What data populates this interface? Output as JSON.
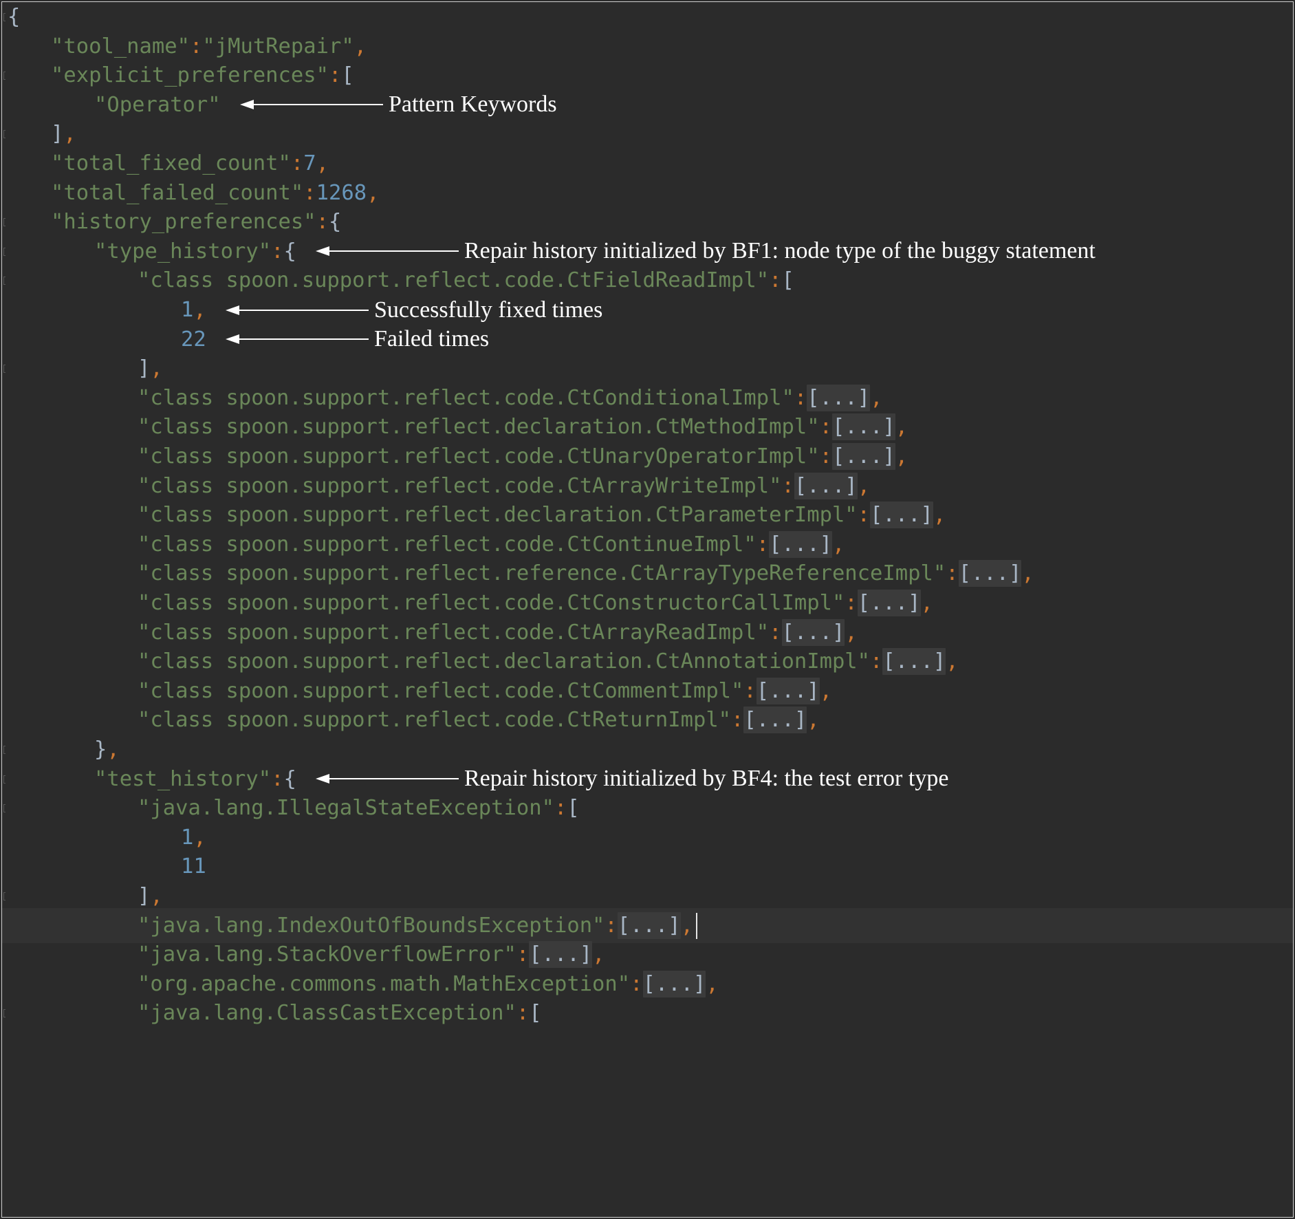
{
  "editor": {
    "language": "json",
    "lines": [
      {
        "indent": 0,
        "tokens": [
          {
            "t": "{",
            "c": "b"
          }
        ]
      },
      {
        "indent": 1,
        "tokens": [
          {
            "t": "\"tool_name\"",
            "c": "s"
          },
          {
            "t": ":",
            "c": "p"
          },
          {
            "t": "\"jMutRepair\"",
            "c": "s"
          },
          {
            "t": ",",
            "c": "p"
          }
        ]
      },
      {
        "indent": 1,
        "tokens": [
          {
            "t": "\"explicit_preferences\"",
            "c": "s"
          },
          {
            "t": ":",
            "c": "p"
          },
          {
            "t": "[",
            "c": "b"
          }
        ]
      },
      {
        "indent": 2,
        "tokens": [
          {
            "t": "\"Operator\"",
            "c": "s"
          }
        ]
      },
      {
        "indent": 1,
        "tokens": [
          {
            "t": "]",
            "c": "b"
          },
          {
            "t": ",",
            "c": "p"
          }
        ]
      },
      {
        "indent": 1,
        "tokens": [
          {
            "t": "\"total_fixed_count\"",
            "c": "s"
          },
          {
            "t": ":",
            "c": "p"
          },
          {
            "t": "7",
            "c": "n"
          },
          {
            "t": ",",
            "c": "p"
          }
        ]
      },
      {
        "indent": 1,
        "tokens": [
          {
            "t": "\"total_failed_count\"",
            "c": "s"
          },
          {
            "t": ":",
            "c": "p"
          },
          {
            "t": "1268",
            "c": "n"
          },
          {
            "t": ",",
            "c": "p"
          }
        ]
      },
      {
        "indent": 1,
        "tokens": [
          {
            "t": "\"history_preferences\"",
            "c": "s"
          },
          {
            "t": ":",
            "c": "p"
          },
          {
            "t": "{",
            "c": "b"
          }
        ]
      },
      {
        "indent": 2,
        "tokens": [
          {
            "t": "\"type_history\"",
            "c": "s"
          },
          {
            "t": ":",
            "c": "p"
          },
          {
            "t": "{",
            "c": "b"
          }
        ]
      },
      {
        "indent": 3,
        "tokens": [
          {
            "t": "\"class spoon.support.reflect.code.CtFieldReadImpl\"",
            "c": "s"
          },
          {
            "t": ":",
            "c": "p"
          },
          {
            "t": "[",
            "c": "b"
          }
        ]
      },
      {
        "indent": 4,
        "tokens": [
          {
            "t": "1",
            "c": "n"
          },
          {
            "t": ",",
            "c": "p"
          }
        ]
      },
      {
        "indent": 4,
        "tokens": [
          {
            "t": "22",
            "c": "n"
          }
        ]
      },
      {
        "indent": 3,
        "tokens": [
          {
            "t": "]",
            "c": "b"
          },
          {
            "t": ",",
            "c": "p"
          }
        ]
      },
      {
        "indent": 3,
        "tokens": [
          {
            "t": "\"class spoon.support.reflect.code.CtConditionalImpl\"",
            "c": "s"
          },
          {
            "t": ":",
            "c": "p"
          },
          {
            "t": "[...]",
            "c": "fold"
          },
          {
            "t": ",",
            "c": "p"
          }
        ]
      },
      {
        "indent": 3,
        "tokens": [
          {
            "t": "\"class spoon.support.reflect.declaration.CtMethodImpl\"",
            "c": "s"
          },
          {
            "t": ":",
            "c": "p"
          },
          {
            "t": "[...]",
            "c": "fold"
          },
          {
            "t": ",",
            "c": "p"
          }
        ]
      },
      {
        "indent": 3,
        "tokens": [
          {
            "t": "\"class spoon.support.reflect.code.CtUnaryOperatorImpl\"",
            "c": "s"
          },
          {
            "t": ":",
            "c": "p"
          },
          {
            "t": "[...]",
            "c": "fold"
          },
          {
            "t": ",",
            "c": "p"
          }
        ]
      },
      {
        "indent": 3,
        "tokens": [
          {
            "t": "\"class spoon.support.reflect.code.CtArrayWriteImpl\"",
            "c": "s"
          },
          {
            "t": ":",
            "c": "p"
          },
          {
            "t": "[...]",
            "c": "fold"
          },
          {
            "t": ",",
            "c": "p"
          }
        ]
      },
      {
        "indent": 3,
        "tokens": [
          {
            "t": "\"class spoon.support.reflect.declaration.CtParameterImpl\"",
            "c": "s"
          },
          {
            "t": ":",
            "c": "p"
          },
          {
            "t": "[...]",
            "c": "fold"
          },
          {
            "t": ",",
            "c": "p"
          }
        ]
      },
      {
        "indent": 3,
        "tokens": [
          {
            "t": "\"class spoon.support.reflect.code.CtContinueImpl\"",
            "c": "s"
          },
          {
            "t": ":",
            "c": "p"
          },
          {
            "t": "[...]",
            "c": "fold"
          },
          {
            "t": ",",
            "c": "p"
          }
        ]
      },
      {
        "indent": 3,
        "tokens": [
          {
            "t": "\"class spoon.support.reflect.reference.CtArrayTypeReferenceImpl\"",
            "c": "s"
          },
          {
            "t": ":",
            "c": "p"
          },
          {
            "t": "[...]",
            "c": "fold"
          },
          {
            "t": ",",
            "c": "p"
          }
        ]
      },
      {
        "indent": 3,
        "tokens": [
          {
            "t": "\"class spoon.support.reflect.code.CtConstructorCallImpl\"",
            "c": "s"
          },
          {
            "t": ":",
            "c": "p"
          },
          {
            "t": "[...]",
            "c": "fold"
          },
          {
            "t": ",",
            "c": "p"
          }
        ]
      },
      {
        "indent": 3,
        "tokens": [
          {
            "t": "\"class spoon.support.reflect.code.CtArrayReadImpl\"",
            "c": "s"
          },
          {
            "t": ":",
            "c": "p"
          },
          {
            "t": "[...]",
            "c": "fold"
          },
          {
            "t": ",",
            "c": "p"
          }
        ]
      },
      {
        "indent": 3,
        "tokens": [
          {
            "t": "\"class spoon.support.reflect.declaration.CtAnnotationImpl\"",
            "c": "s"
          },
          {
            "t": ":",
            "c": "p"
          },
          {
            "t": "[...]",
            "c": "fold"
          },
          {
            "t": ",",
            "c": "p"
          }
        ]
      },
      {
        "indent": 3,
        "tokens": [
          {
            "t": "\"class spoon.support.reflect.code.CtCommentImpl\"",
            "c": "s"
          },
          {
            "t": ":",
            "c": "p"
          },
          {
            "t": "[...]",
            "c": "fold"
          },
          {
            "t": ",",
            "c": "p"
          }
        ]
      },
      {
        "indent": 3,
        "tokens": [
          {
            "t": "\"class spoon.support.reflect.code.CtReturnImpl\"",
            "c": "s"
          },
          {
            "t": ":",
            "c": "p"
          },
          {
            "t": "[...]",
            "c": "fold"
          },
          {
            "t": ",",
            "c": "p"
          }
        ]
      },
      {
        "indent": 2,
        "tokens": [
          {
            "t": "}",
            "c": "b"
          },
          {
            "t": ",",
            "c": "p"
          }
        ]
      },
      {
        "indent": 2,
        "tokens": [
          {
            "t": "\"test_history\"",
            "c": "s"
          },
          {
            "t": ":",
            "c": "p"
          },
          {
            "t": "{",
            "c": "b"
          }
        ]
      },
      {
        "indent": 3,
        "tokens": [
          {
            "t": "\"java.lang.IllegalStateException\"",
            "c": "s"
          },
          {
            "t": ":",
            "c": "p"
          },
          {
            "t": "[",
            "c": "b"
          }
        ]
      },
      {
        "indent": 4,
        "tokens": [
          {
            "t": "1",
            "c": "n"
          },
          {
            "t": ",",
            "c": "p"
          }
        ]
      },
      {
        "indent": 4,
        "tokens": [
          {
            "t": "11",
            "c": "n"
          }
        ]
      },
      {
        "indent": 3,
        "tokens": [
          {
            "t": "]",
            "c": "b"
          },
          {
            "t": ",",
            "c": "p"
          }
        ]
      },
      {
        "indent": 3,
        "current": true,
        "tokens": [
          {
            "t": "\"java.lang.IndexOutOfBoundsException\"",
            "c": "s"
          },
          {
            "t": ":",
            "c": "p"
          },
          {
            "t": "[...]",
            "c": "fold"
          },
          {
            "t": ",",
            "c": "p"
          }
        ]
      },
      {
        "indent": 3,
        "tokens": [
          {
            "t": "\"java.lang.StackOverflowError\"",
            "c": "s"
          },
          {
            "t": ":",
            "c": "p"
          },
          {
            "t": "[...]",
            "c": "fold"
          },
          {
            "t": ",",
            "c": "p"
          }
        ]
      },
      {
        "indent": 3,
        "tokens": [
          {
            "t": "\"org.apache.commons.math.MathException\"",
            "c": "s"
          },
          {
            "t": ":",
            "c": "p"
          },
          {
            "t": "[...]",
            "c": "fold"
          },
          {
            "t": ",",
            "c": "p"
          }
        ]
      },
      {
        "indent": 3,
        "tokens": [
          {
            "t": "\"java.lang.ClassCastException\"",
            "c": "s"
          },
          {
            "t": ":",
            "c": "p"
          },
          {
            "t": "[",
            "c": "b"
          }
        ]
      }
    ]
  },
  "annotations": [
    {
      "line": 3,
      "text": "Pattern Keywords"
    },
    {
      "line": 8,
      "text": "Repair history initialized by BF1: node type of the buggy statement"
    },
    {
      "line": 10,
      "text": "Successfully fixed times"
    },
    {
      "line": 11,
      "text": "Failed times"
    },
    {
      "line": 26,
      "text": "Repair history initialized by BF4: the test error type"
    }
  ],
  "colors": {
    "background": "#2b2b2b",
    "string": "#6a8759",
    "number": "#6897bb",
    "punctuation": "#cc7832",
    "bracket": "#a9b7c6",
    "annotation_text": "#ffffff"
  }
}
